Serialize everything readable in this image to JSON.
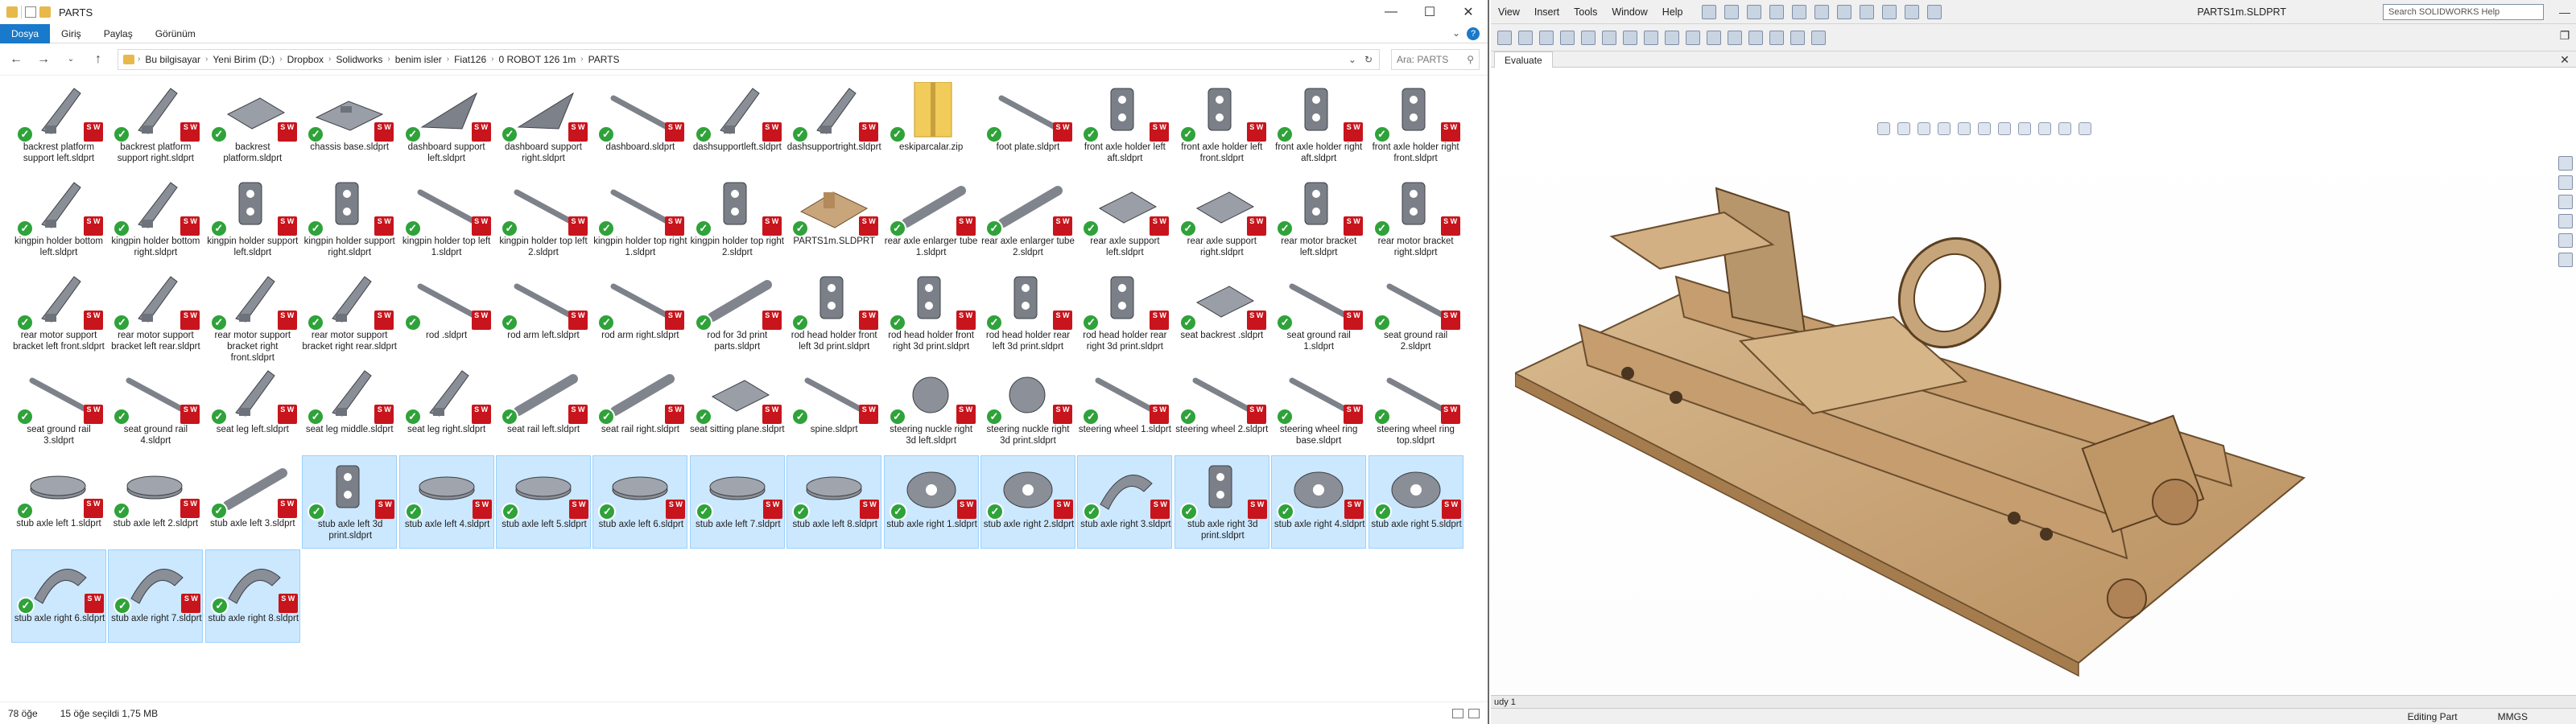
{
  "explorer": {
    "title": "PARTS",
    "ribbon_tabs": [
      "Dosya",
      "Giriş",
      "Paylaş",
      "Görünüm"
    ],
    "breadcrumb": [
      "Bu bilgisayar",
      "Yeni Birim (D:)",
      "Dropbox",
      "Solidworks",
      "benim isler",
      "Fiat126",
      "0 ROBOT 126 1m",
      "PARTS"
    ],
    "search_placeholder": "Ara: PARTS",
    "status_count": "78 öğe",
    "status_selected": "15 öğe seçildi  1,75 MB",
    "files": [
      {
        "name": "backrest platform support left.sldprt",
        "shape": "bracket"
      },
      {
        "name": "backrest platform support right.sldprt",
        "shape": "bracket"
      },
      {
        "name": "backrest platform.sldprt",
        "shape": "plate"
      },
      {
        "name": "chassis base.sldprt",
        "shape": "plate2"
      },
      {
        "name": "dashboard support left.sldprt",
        "shape": "tri"
      },
      {
        "name": "dashboard support right.sldprt",
        "shape": "tri"
      },
      {
        "name": "dashboard.sldprt",
        "shape": "rod"
      },
      {
        "name": "dashsupportleft.sldprt",
        "shape": "bracket"
      },
      {
        "name": "dashsupportright.sldprt",
        "shape": "bracket"
      },
      {
        "name": "eskiparcalar.zip",
        "shape": "zip"
      },
      {
        "name": "foot plate.sldprt",
        "shape": "rod"
      },
      {
        "name": "front axle holder left aft.sldprt",
        "shape": "holder"
      },
      {
        "name": "front axle holder left front.sldprt",
        "shape": "holder"
      },
      {
        "name": "front axle holder right aft.sldprt",
        "shape": "holder"
      },
      {
        "name": "front axle holder right front.sldprt",
        "shape": "holder"
      },
      {
        "name": "kingpin holder bottom left.sldprt",
        "shape": "bracket"
      },
      {
        "name": "kingpin holder bottom right.sldprt",
        "shape": "bracket"
      },
      {
        "name": "kingpin holder support left.sldprt",
        "shape": "holder"
      },
      {
        "name": "kingpin holder support right.sldprt",
        "shape": "holder"
      },
      {
        "name": "kingpin holder top left 1.sldprt",
        "shape": "rod"
      },
      {
        "name": "kingpin holder top left 2.sldprt",
        "shape": "rod"
      },
      {
        "name": "kingpin holder top right 1.sldprt",
        "shape": "rod"
      },
      {
        "name": "kingpin holder top right 2.sldprt",
        "shape": "holder"
      },
      {
        "name": "PARTS1m.SLDPRT",
        "shape": "assembly"
      },
      {
        "name": "rear axle enlarger tube 1.sldprt",
        "shape": "tube"
      },
      {
        "name": "rear axle enlarger tube 2.sldprt",
        "shape": "tube"
      },
      {
        "name": "rear axle support left.sldprt",
        "shape": "plate"
      },
      {
        "name": "rear axle support right.sldprt",
        "shape": "plate"
      },
      {
        "name": "rear motor bracket left.sldprt",
        "shape": "holder"
      },
      {
        "name": "rear motor bracket right.sldprt",
        "shape": "holder"
      },
      {
        "name": "rear motor support bracket left front.sldprt",
        "shape": "bracket"
      },
      {
        "name": "rear motor support bracket left rear.sldprt",
        "shape": "bracket"
      },
      {
        "name": "rear motor support bracket right front.sldprt",
        "shape": "bracket"
      },
      {
        "name": "rear motor support bracket right rear.sldprt",
        "shape": "bracket"
      },
      {
        "name": "rod .sldprt",
        "shape": "rod"
      },
      {
        "name": "rod arm left.sldprt",
        "shape": "rod"
      },
      {
        "name": "rod arm right.sldprt",
        "shape": "rod"
      },
      {
        "name": "rod for 3d print parts.sldprt",
        "shape": "tube"
      },
      {
        "name": "rod head holder front left 3d print.sldprt",
        "shape": "holder"
      },
      {
        "name": "rod head holder front right 3d print.sldprt",
        "shape": "holder"
      },
      {
        "name": "rod head holder rear left 3d print.sldprt",
        "shape": "holder"
      },
      {
        "name": "rod head holder rear right 3d print.sldprt",
        "shape": "holder"
      },
      {
        "name": "seat backrest .sldprt",
        "shape": "plate"
      },
      {
        "name": "seat ground rail 1.sldprt",
        "shape": "rod"
      },
      {
        "name": "seat ground rail 2.sldprt",
        "shape": "rod"
      },
      {
        "name": "seat ground rail 3.sldprt",
        "shape": "rod"
      },
      {
        "name": "seat ground rail 4.sldprt",
        "shape": "rod"
      },
      {
        "name": "seat leg left.sldprt",
        "shape": "bracket"
      },
      {
        "name": "seat leg middle.sldprt",
        "shape": "bracket"
      },
      {
        "name": "seat leg right.sldprt",
        "shape": "bracket"
      },
      {
        "name": "seat rail left.sldprt",
        "shape": "tube"
      },
      {
        "name": "seat rail right.sldprt",
        "shape": "tube"
      },
      {
        "name": "seat sitting plane.sldprt",
        "shape": "plate"
      },
      {
        "name": "spine.sldprt",
        "shape": "rod"
      },
      {
        "name": "steering nuckle right 3d left.sldprt",
        "shape": "ball"
      },
      {
        "name": "steering nuckle right 3d print.sldprt",
        "shape": "ball"
      },
      {
        "name": "steering wheel 1.sldprt",
        "shape": "rod"
      },
      {
        "name": "steering wheel 2.sldprt",
        "shape": "rod"
      },
      {
        "name": "steering wheel ring base.sldprt",
        "shape": "rod"
      },
      {
        "name": "steering wheel ring top.sldprt",
        "shape": "rod"
      },
      {
        "name": "stub axle left 1.sldprt",
        "shape": "cyl"
      },
      {
        "name": "stub axle left 2.sldprt",
        "shape": "cyl"
      },
      {
        "name": "stub axle left 3.sldprt",
        "shape": "tube"
      },
      {
        "name": "stub axle left 3d print.sldprt",
        "shape": "holder",
        "selected": true
      },
      {
        "name": "stub axle left 4.sldprt",
        "shape": "cyl",
        "selected": true
      },
      {
        "name": "stub axle left 5.sldprt",
        "shape": "cyl",
        "selected": true
      },
      {
        "name": "stub axle left 6.sldprt",
        "shape": "cyl",
        "selected": true
      },
      {
        "name": "stub axle left 7.sldprt",
        "shape": "cyl",
        "selected": true
      },
      {
        "name": "stub axle left 8.sldprt",
        "shape": "cyl",
        "selected": true
      },
      {
        "name": "stub axle right 1.sldprt",
        "shape": "disc",
        "selected": true
      },
      {
        "name": "stub axle right 2.sldprt",
        "shape": "disc",
        "selected": true
      },
      {
        "name": "stub axle right 3.sldprt",
        "shape": "arc",
        "selected": true
      },
      {
        "name": "stub axle right 3d print.sldprt",
        "shape": "holder",
        "selected": true
      },
      {
        "name": "stub axle right 4.sldprt",
        "shape": "disc",
        "selected": true
      },
      {
        "name": "stub axle right 5.sldprt",
        "shape": "disc",
        "selected": true
      },
      {
        "name": "stub axle right 6.sldprt",
        "shape": "arc",
        "selected": true
      },
      {
        "name": "stub axle right 7.sldprt",
        "shape": "arc",
        "selected": true
      },
      {
        "name": "stub axle right 8.sldprt",
        "shape": "arc",
        "selected": true
      }
    ]
  },
  "solidworks": {
    "menus": [
      "View",
      "Insert",
      "Tools",
      "Window",
      "Help"
    ],
    "doc_title": "PARTS1m.SLDPRT",
    "search_placeholder": "Search SOLIDWORKS Help",
    "tab": "Evaluate",
    "bottom_tab": "udy 1",
    "status_mode": "Editing Part",
    "status_units": "MMGS"
  },
  "colors": {
    "accent": "#1979ca",
    "select_bg": "#cce8ff",
    "check_green": "#2fa23a",
    "sw_red": "#c8141c",
    "wood": "#c9a57b"
  }
}
